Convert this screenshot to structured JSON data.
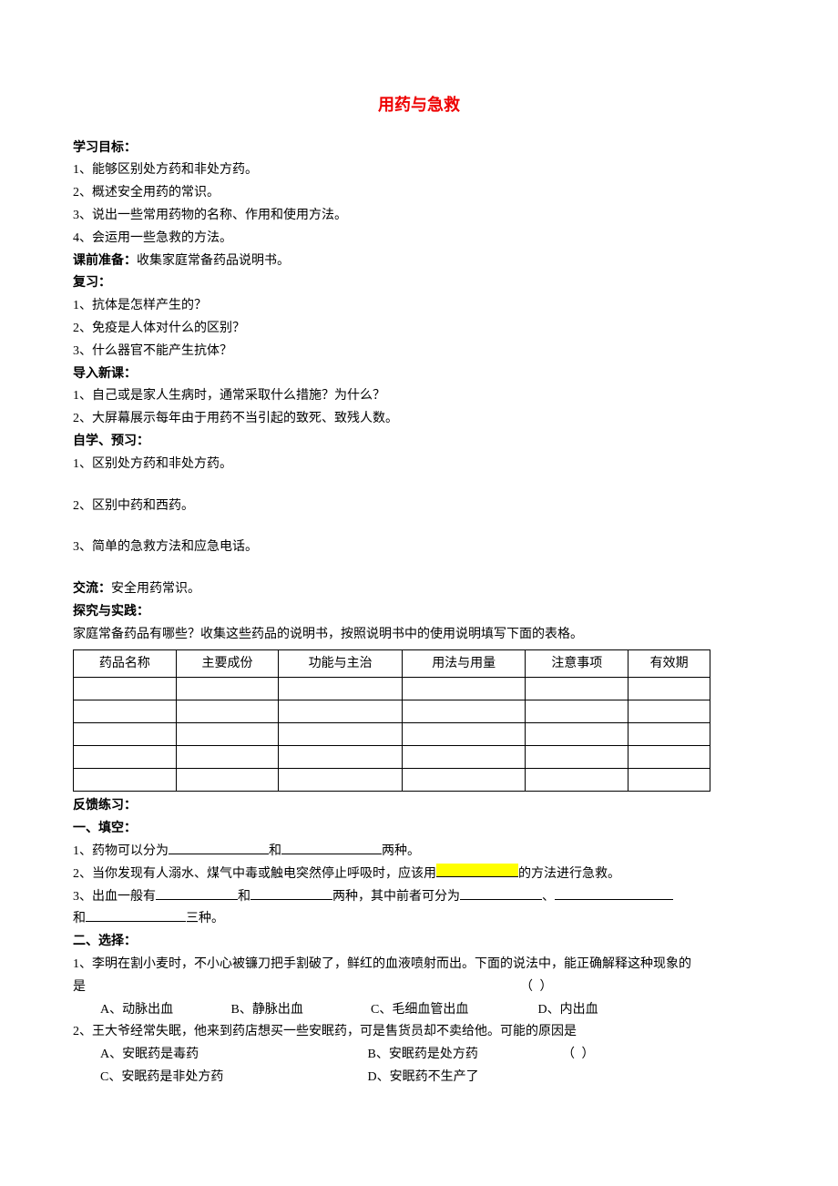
{
  "title": "用药与急救",
  "sections": {
    "objectives_heading": "学习目标：",
    "objectives": [
      "1、能够区别处方药和非处方药。",
      "2、概述安全用药的常识。",
      "3、说出一些常用药物的名称、作用和使用方法。",
      "4、会运用一些急救的方法。"
    ],
    "prep_heading": "课前准备：",
    "prep_text": "收集家庭常备药品说明书。",
    "review_heading": "复习：",
    "review": [
      "1、抗体是怎样产生的？",
      "2、免疫是人体对什么的区别？",
      "3、什么器官不能产生抗体？"
    ],
    "intro_heading": "导入新课：",
    "intro": [
      "1、自己或是家人生病时，通常采取什么措施？为什么？",
      "2、大屏幕展示每年由于用药不当引起的致死、致残人数。"
    ],
    "selfstudy_heading": "自学、预习：",
    "selfstudy": [
      "1、区别处方药和非处方药。",
      "2、区别中药和西药。",
      "3、简单的急救方法和应急电话。"
    ],
    "exchange_heading": "交流：",
    "exchange_text": "安全用药常识。",
    "explore_heading": "探究与实践：",
    "explore_text": "家庭常备药品有哪些？收集这些药品的说明书，按照说明书中的使用说明填写下面的表格。",
    "table_headers": [
      "药品名称",
      "主要成份",
      "功能与主治",
      "用法与用量",
      "注意事项",
      "有效期"
    ],
    "feedback_heading": "反馈练习：",
    "fill_heading": "一、填空：",
    "fill": {
      "q1_a": "1、药物可以分为",
      "q1_b": "和",
      "q1_c": "两种。",
      "q2_a": "2、当你发现有人溺水、煤气中毒或触电突然停止呼吸时，应该用",
      "q2_b": "的方法进行急救。",
      "q3_a": "3、出血一般有",
      "q3_b": "和",
      "q3_c": "两种，其中前者可分为",
      "q3_d": "、",
      "q3_e": "和",
      "q3_f": "三种。"
    },
    "choice_heading": "二、选择：",
    "choice": {
      "q1_text_a": "1、李明在割小麦时，不小心被镰刀把手割破了，鲜红的血液喷射而出。下面的说法中，能正确解释这种现象的",
      "q1_text_b": "是",
      "q1_paren": "（     ）",
      "q1_opts": {
        "a": "A、动脉出血",
        "b": "B、静脉出血",
        "c": "C、毛细血管出血",
        "d": "D、内出血"
      },
      "q2_text": "2、王大爷经常失眠，他来到药店想买一些安眠药，可是售货员却不卖给他。可能的原因是",
      "q2_paren": "（     ）",
      "q2_opts": {
        "a": "A、安眠药是毒药",
        "b": "B、安眠药是处方药",
        "c": "C、安眠药是非处方药",
        "d": "D、安眠药不生产了"
      }
    }
  }
}
